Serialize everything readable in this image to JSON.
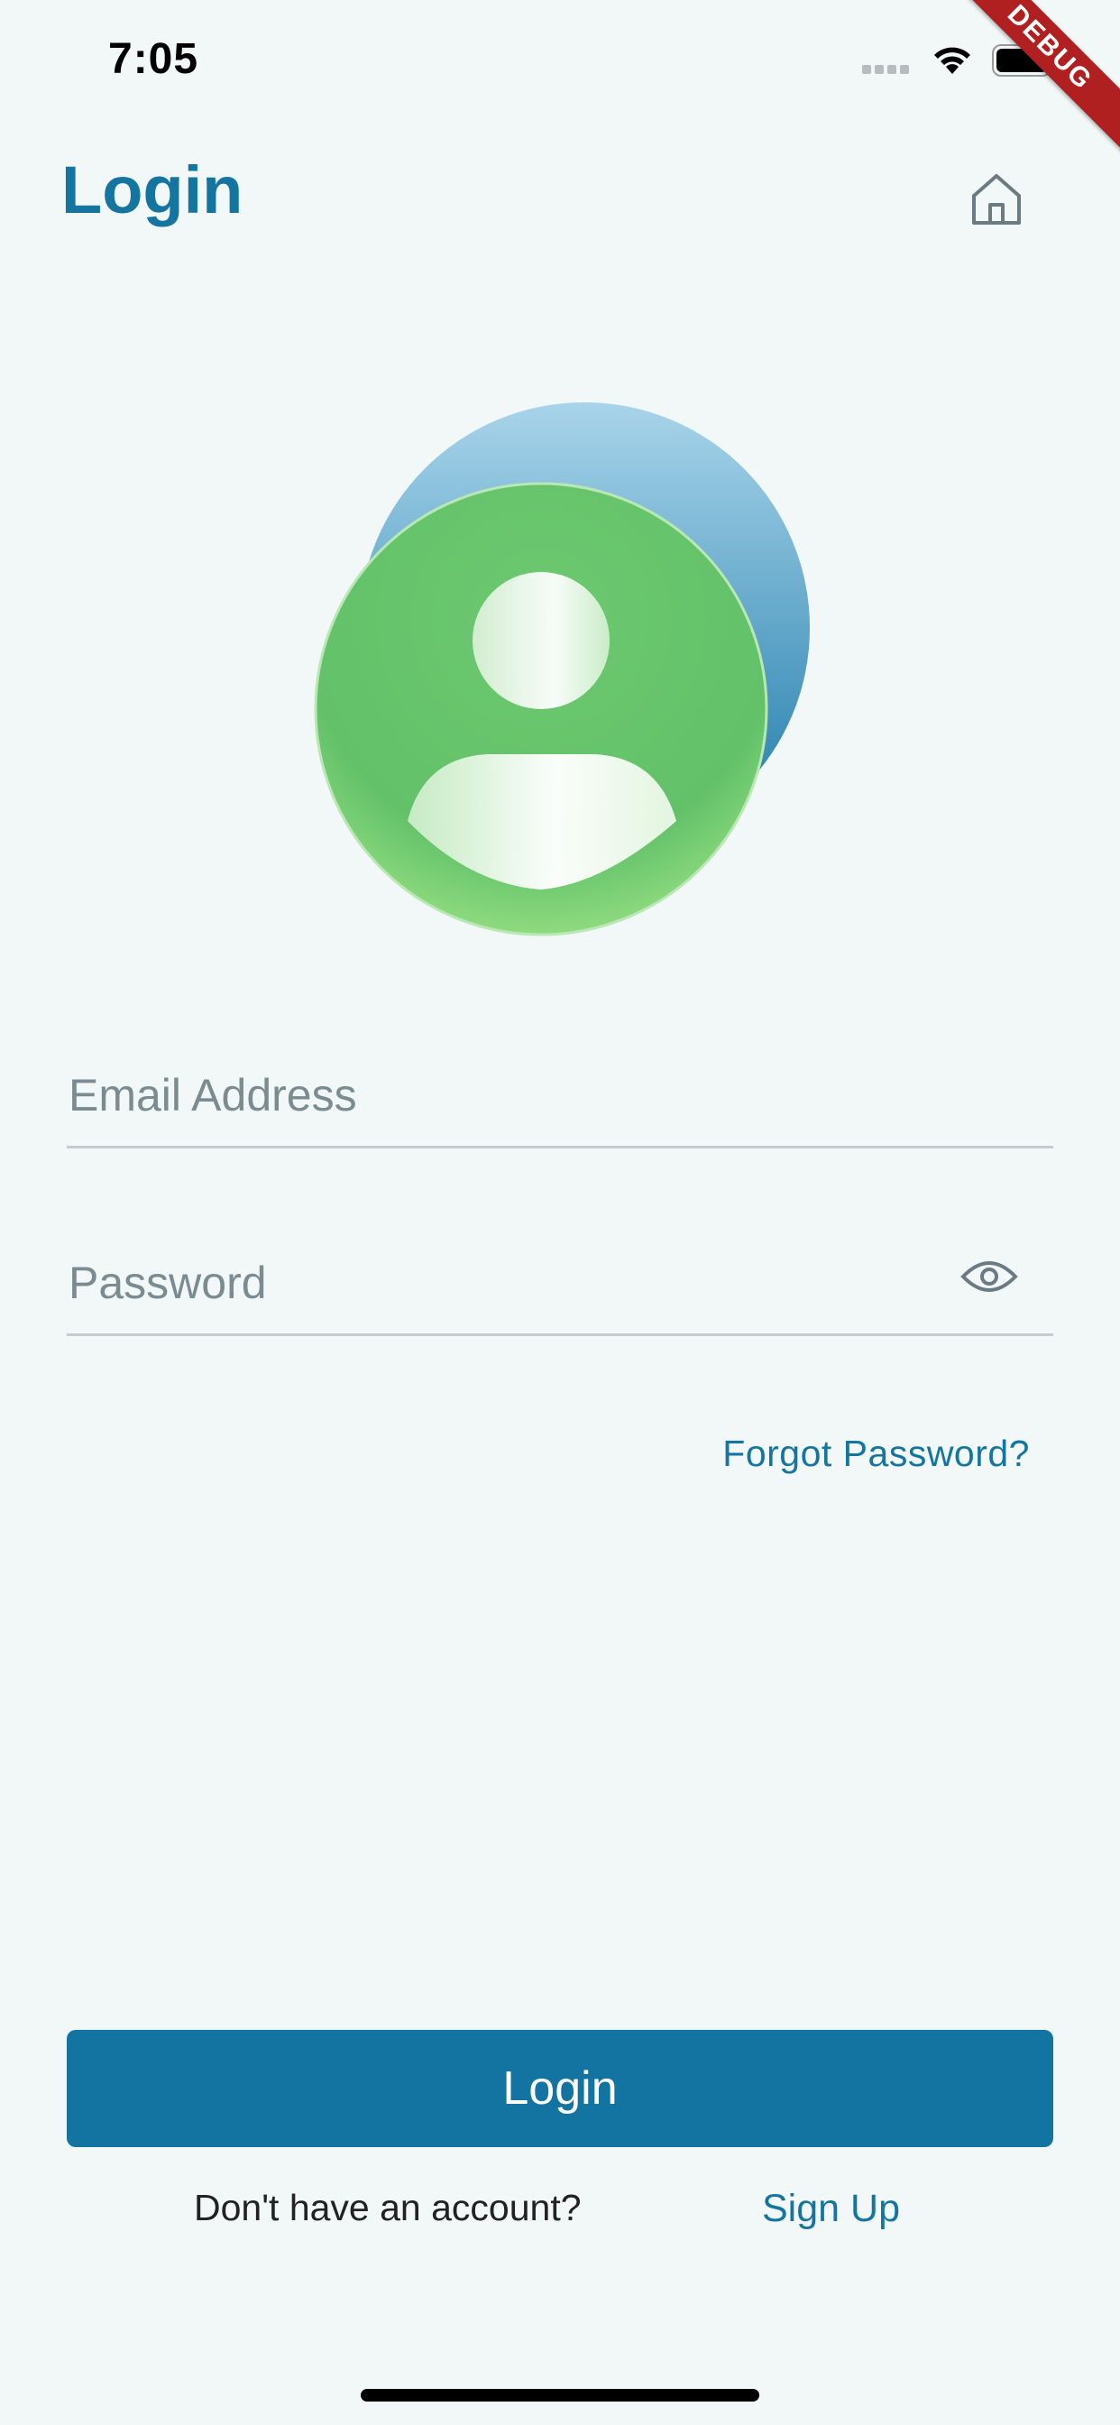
{
  "status_bar": {
    "time": "7:05",
    "debug_label": "DEBUG"
  },
  "header": {
    "title": "Login",
    "home_icon": "home-icon"
  },
  "form": {
    "email": {
      "value": "",
      "placeholder": "Email Address"
    },
    "password": {
      "value": "",
      "placeholder": "Password",
      "toggle_icon": "eye-icon"
    },
    "forgot_password": "Forgot Password?",
    "submit_label": "Login"
  },
  "footer": {
    "prompt": "Don't have an account?",
    "signup_label": "Sign Up"
  },
  "colors": {
    "background": "#f2f7f8",
    "accent": "#1476a0",
    "avatar_green": "#6cc86f",
    "avatar_blue": "#1a78a8"
  }
}
